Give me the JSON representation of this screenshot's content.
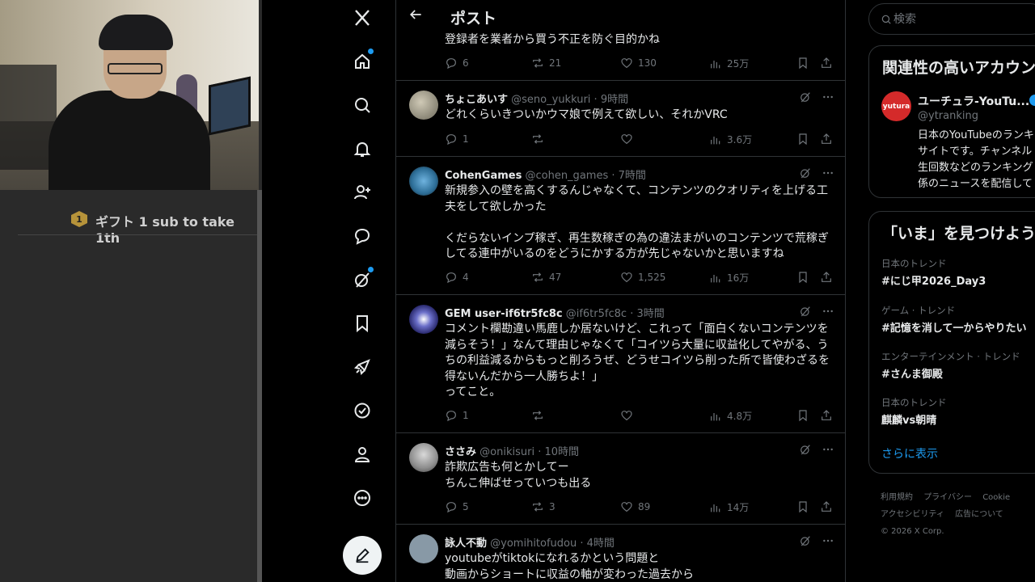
{
  "stream": {
    "chat_badge": "1",
    "chat_text": "ギフト 1 sub to take 1th"
  },
  "nav": {
    "items": [
      {
        "name": "x-logo"
      },
      {
        "name": "home",
        "dot": true
      },
      {
        "name": "explore"
      },
      {
        "name": "notifications"
      },
      {
        "name": "follow"
      },
      {
        "name": "messages"
      },
      {
        "name": "grok",
        "dot": true
      },
      {
        "name": "bookmarks"
      },
      {
        "name": "business"
      },
      {
        "name": "verified"
      },
      {
        "name": "profile"
      },
      {
        "name": "more"
      }
    ]
  },
  "header": {
    "title": "ポスト"
  },
  "prev_post": {
    "text": "登録者を業者から買う不正を防ぐ目的かね",
    "replies": "6",
    "reposts": "21",
    "likes": "130",
    "views": "25万"
  },
  "posts": [
    {
      "name": "ちょこあいす",
      "handle": "@seno_yukkuri",
      "time": "9時間",
      "body": "どれくらいきついかウマ娘で例えて欲しい、それかVRC",
      "replies": "1",
      "reposts": "",
      "likes": "",
      "views": "3.6万"
    },
    {
      "name": "CohenGames",
      "handle": "@cohen_games",
      "time": "7時間",
      "body": "新規参入の壁を高くするんじゃなくて、コンテンツのクオリティを上げる工夫をして欲しかった\n\nくだらないインプ稼ぎ、再生数稼ぎの為の違法まがいのコンテンツで荒稼ぎしてる連中がいるのをどうにかする方が先じゃないかと思いますね",
      "replies": "4",
      "reposts": "47",
      "likes": "1,525",
      "views": "16万"
    },
    {
      "name": "GEM user-if6tr5fc8c",
      "handle": "@if6tr5fc8c",
      "time": "3時間",
      "body": "コメント欄勘違い馬鹿しか居ないけど、これって「面白くないコンテンツを減らそう！」なんて理由じゃなくて「コイツら大量に収益化してやがる、うちの利益減るからもっと削ろうぜ、どうせコイツら削った所で皆使わざるを得ないんだから一人勝ちよ！」\nってこと。",
      "replies": "1",
      "reposts": "",
      "likes": "",
      "views": "4.8万"
    },
    {
      "name": "ささみ",
      "handle": "@onikisuri",
      "time": "10時間",
      "body": "詐欺広告も何とかしてー\nちんこ伸ばせっていつも出る",
      "replies": "5",
      "reposts": "3",
      "likes": "89",
      "views": "14万"
    },
    {
      "name": "詠人不動",
      "handle": "@yomihitofudou",
      "time": "4時間",
      "body": "youtubeがtiktokになれるかという問題と\n動画からショートに収益の軸が変わった過去から"
    }
  ],
  "sidebar": {
    "search_placeholder": "検索",
    "related_title": "関連性の高いアカウン",
    "related_account": {
      "avatar_text": "yutura",
      "name": "ユーチュラ-YouTu...",
      "handle": "@ytranking",
      "bio": "日本のYouTubeのランキ\nサイトです。チャンネル\n生回数などのランキング\n係のニュースを配信して"
    },
    "trends_title": "「いま」を見つけよう",
    "trends": [
      {
        "meta": "日本のトレンド",
        "name": "#にじ甲2026_Day3"
      },
      {
        "meta": "ゲーム · トレンド",
        "name": "#記憶を消して一からやりたい"
      },
      {
        "meta": "エンターテインメント · トレンド",
        "name": "#さんま御殿"
      },
      {
        "meta": "日本のトレンド",
        "name": "麒麟vs朝晴"
      }
    ],
    "show_more": "さらに表示",
    "footer": {
      "links": [
        "利用規約",
        "プライバシー",
        "Cookie",
        "アクセシビリティ",
        "広告について"
      ],
      "copyright": "© 2026 X Corp."
    }
  }
}
